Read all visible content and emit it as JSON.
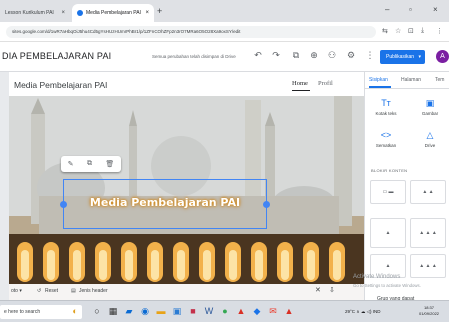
{
  "browser": {
    "tabs": [
      {
        "label": "Lesson Kurikulum PAI"
      },
      {
        "label": "Media Pembelajaran PAI"
      }
    ],
    "tab_close": "×",
    "new_tab": "+",
    "window_controls": [
      "–",
      "▫",
      "×"
    ],
    "url": "sites.google.com/d/1wR7aHbqOiJ5hu4Cd5gYsHUzHUmrPhBr1/p/1ZFnCOhZFp2n3rO7MRa6O5O28Xa9oxSY/edit",
    "address_icons": [
      "⇆",
      "☆",
      "⊡",
      "⤓",
      "⋮"
    ]
  },
  "sites_toolbar": {
    "site_title": "DIA PEMBELAJARAN PAI",
    "save_note": "Semua perubahan telah disimpan di Drive",
    "icons": [
      "↶",
      "↷",
      "⧉",
      "⊕",
      "⚇",
      "⚙",
      "⋮"
    ],
    "publish_label": "Publikasikan",
    "publish_arrow": "▾",
    "avatar_letter": "A"
  },
  "site": {
    "name": "Media Pembelajaran PAI",
    "nav": [
      "Home",
      "Profil"
    ],
    "hero_title": "Media Pembelajaran PAI",
    "float_toolbar": [
      "✎",
      "⧉",
      "🗑"
    ],
    "hero_toolbar": {
      "left_label": "oto ▾",
      "reset_label": "Reset",
      "reset_icon": "↺",
      "header_type_label": "Jenis header",
      "header_type_icon": "▤",
      "right_icons": [
        "✕",
        "⇩"
      ]
    }
  },
  "panel": {
    "tabs": [
      "Sisipkan",
      "Halaman",
      "Tem"
    ],
    "insert_items": [
      {
        "icon": "Tт",
        "label": "Kotak teks"
      },
      {
        "icon": "▣",
        "label": "Gambar"
      },
      {
        "icon": "<>",
        "label": "Sematkan"
      },
      {
        "icon": "△",
        "label": "Drive"
      }
    ],
    "section_heading": "BLOKIR KONTEN",
    "layout_glyphs": [
      "▭ ▬",
      "▲ ▲",
      "▲",
      "▲ ▲ ▲",
      "▲",
      "▲ ▲ ▲"
    ],
    "watermark_title": "Activate Windows",
    "watermark_sub": "Go to Settings to activate Windows.",
    "group_label": "Grup yang dapat"
  },
  "taskbar": {
    "search_placeholder": "e here to search",
    "tray_text": "29°C  ∧  ☁  ◁)  IND",
    "time": "18:37",
    "date": "01/09/2022"
  },
  "colors": {
    "accent": "#1a73e8",
    "avatar": "#7b1fa2",
    "selection": "#4285f4"
  }
}
